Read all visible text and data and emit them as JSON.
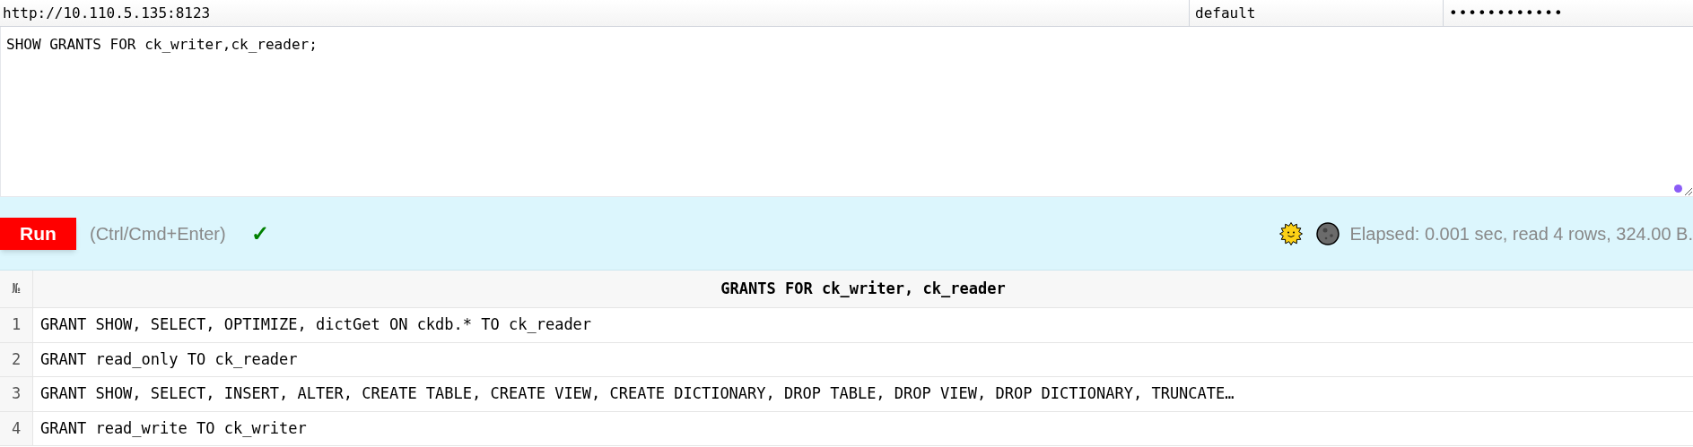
{
  "connection": {
    "url": "http://10.110.5.135:8123",
    "user": "default",
    "password": "••••••••••••"
  },
  "query": "SHOW GRANTS FOR ck_writer,ck_reader;",
  "toolbar": {
    "run_button": "Run",
    "shortcut_hint": "(Ctrl/Cmd+Enter)",
    "status_mark": "✓",
    "stats": "Elapsed: 0.001 sec, read 4 rows, 324.00 B."
  },
  "table": {
    "number_header": "№",
    "columns": [
      "GRANTS FOR ck_writer, ck_reader"
    ],
    "rows": [
      {
        "number": "1",
        "cells": [
          "GRANT SHOW, SELECT, OPTIMIZE, dictGet ON ckdb.* TO ck_reader"
        ]
      },
      {
        "number": "2",
        "cells": [
          "GRANT read_only TO ck_reader"
        ]
      },
      {
        "number": "3",
        "cells": [
          "GRANT SHOW, SELECT, INSERT, ALTER, CREATE TABLE, CREATE VIEW, CREATE DICTIONARY, DROP TABLE, DROP VIEW, DROP DICTIONARY, TRUNCATE…"
        ]
      },
      {
        "number": "4",
        "cells": [
          "GRANT read_write TO ck_writer"
        ]
      }
    ]
  }
}
